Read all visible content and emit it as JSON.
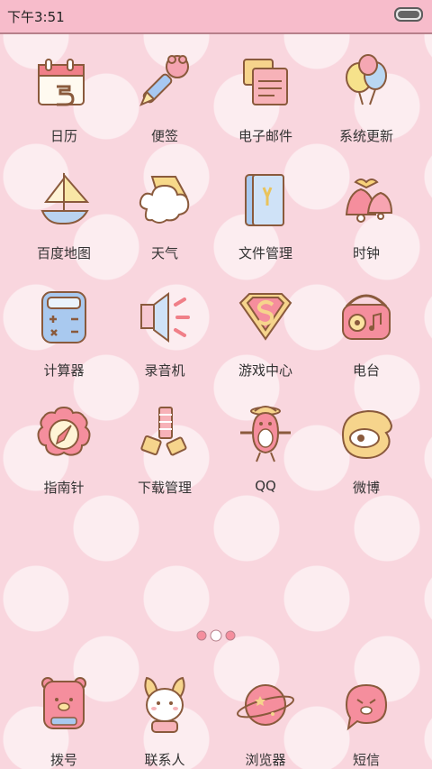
{
  "status_bar": {
    "time": "下午3:51"
  },
  "apps": [
    {
      "label": "日历"
    },
    {
      "label": "便签"
    },
    {
      "label": "电子邮件"
    },
    {
      "label": "系统更新"
    },
    {
      "label": "百度地图"
    },
    {
      "label": "天气"
    },
    {
      "label": "文件管理"
    },
    {
      "label": "时钟"
    },
    {
      "label": "计算器"
    },
    {
      "label": "录音机"
    },
    {
      "label": "游戏中心"
    },
    {
      "label": "电台"
    },
    {
      "label": "指南针"
    },
    {
      "label": "下载管理"
    },
    {
      "label": "QQ"
    },
    {
      "label": "微博"
    }
  ],
  "dock": [
    {
      "label": "拨号"
    },
    {
      "label": "联系人"
    },
    {
      "label": "浏览器"
    },
    {
      "label": "短信"
    }
  ],
  "icons": {
    "calendar": "calendar-icon",
    "notes": "pen-icon",
    "email": "envelope-icon",
    "update": "balloons-icon",
    "map": "sailboat-icon",
    "weather": "cloud-icon",
    "files": "folder-icon",
    "clock": "bell-icon",
    "calculator": "calculator-icon",
    "recorder": "speaker-icon",
    "games": "game-badge-icon",
    "radio": "radio-icon",
    "compass": "compass-icon",
    "downloads": "download-icon",
    "qq": "penguin-icon",
    "weibo": "weibo-icon",
    "phone": "bear-phone-icon",
    "contacts": "bunny-icon",
    "browser": "planet-icon",
    "sms": "chat-icon"
  }
}
